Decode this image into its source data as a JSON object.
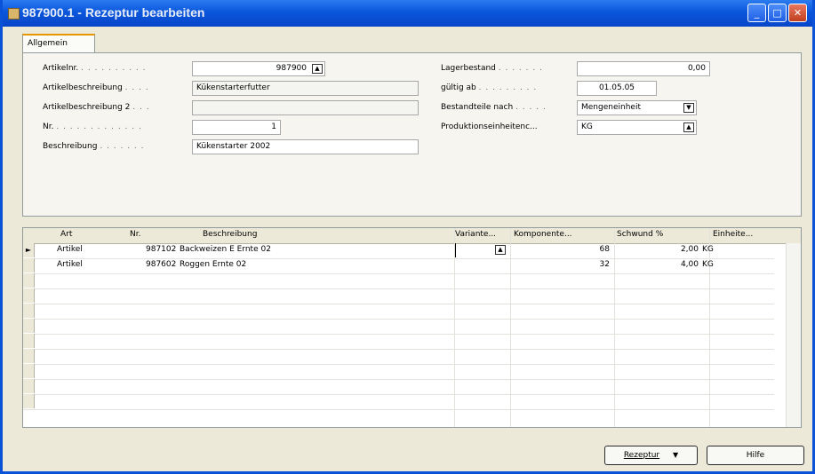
{
  "window": {
    "title": "987900.1 - Rezeptur bearbeiten",
    "minimize_glyph": "_",
    "maximize_glyph": "□",
    "close_glyph": "✕"
  },
  "tabs": [
    {
      "label": "Allgemein",
      "active": true
    }
  ],
  "form": {
    "left": [
      {
        "label": "Artikelnr.",
        "value": "987900",
        "align": "right",
        "button": "lookup"
      },
      {
        "label": "Artikelbeschreibung",
        "value": "Kükenstarterfutter",
        "readonly": true
      },
      {
        "label": "Artikelbeschreibung 2",
        "value": "",
        "readonly": true
      },
      {
        "label": "Nr.",
        "value": "1",
        "align": "right"
      },
      {
        "label": "Beschreibung",
        "value": "Kükenstarter 2002"
      }
    ],
    "right": [
      {
        "label": "Lagerbestand",
        "value": "0,00",
        "align": "right"
      },
      {
        "label": "gültig ab",
        "value": "01.05.05",
        "align": "center"
      },
      {
        "label": "Bestandteile nach",
        "value": "Mengeneinheit",
        "button": "dropdown"
      },
      {
        "label": "Produktionseinheitenc...",
        "value": "KG",
        "button": "lookup"
      }
    ]
  },
  "lines": {
    "columns": [
      "Art",
      "Nr.",
      "Beschreibung",
      "Variante...",
      "Komponente...",
      "Schwund %",
      "Einheite..."
    ],
    "rows": [
      {
        "art": "Artikel",
        "nr": "987102",
        "beschreibung": "Backweizen E Ernte 02",
        "variante": "",
        "komponente": "68",
        "schwund": "2,00",
        "einheit": "KG",
        "current": true
      },
      {
        "art": "Artikel",
        "nr": "987602",
        "beschreibung": "Roggen Ernte 02",
        "variante": "",
        "komponente": "32",
        "schwund": "4,00",
        "einheit": "KG",
        "current": false
      }
    ],
    "empty_rows": 9
  },
  "buttons": {
    "rezeptur": "Rezeptur",
    "hilfe": "Hilfe"
  },
  "colors": {
    "title_bar": "#0a56db",
    "window_face": "#ece9d8",
    "tab_highlight": "#e59700"
  }
}
